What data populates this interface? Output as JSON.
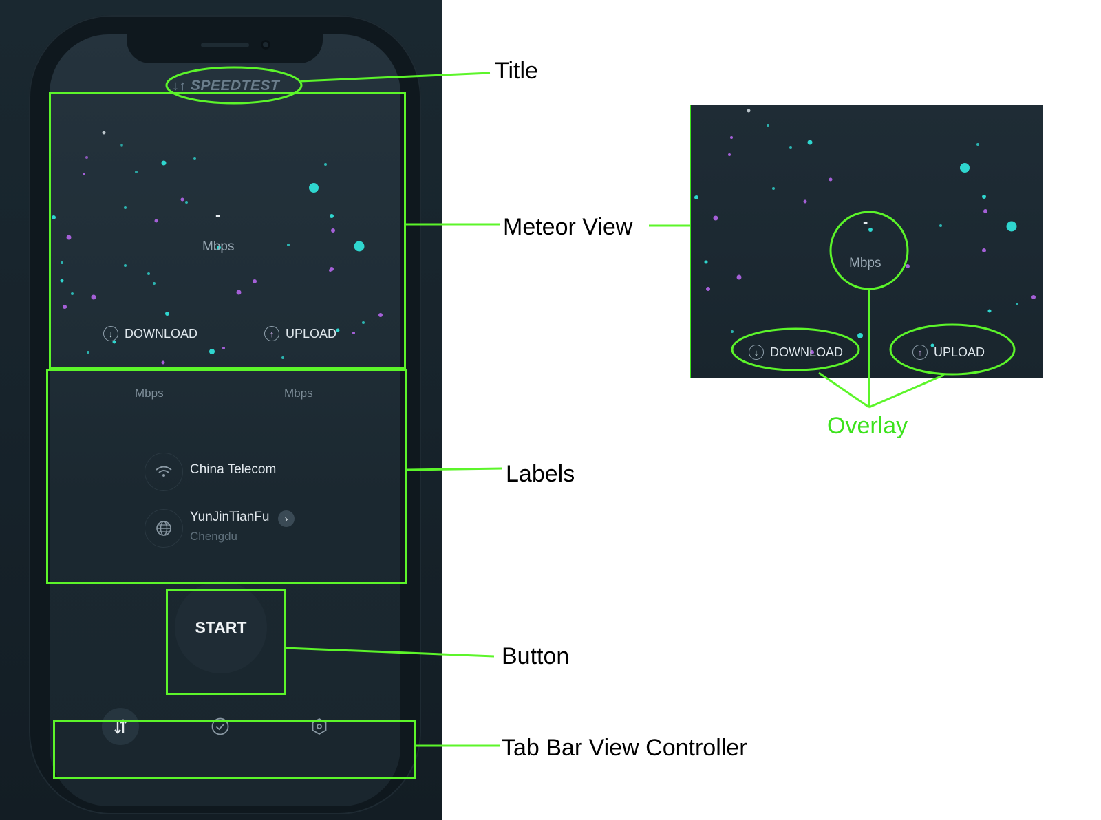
{
  "app": {
    "title": "SPEEDTEST",
    "main_value": "-",
    "main_unit": "Mbps",
    "download_label": "DOWNLOAD",
    "upload_label": "UPLOAD",
    "download_value": "-",
    "download_unit": "Mbps",
    "upload_value": "-",
    "upload_unit": "Mbps",
    "isp_name": "China Telecom",
    "server_name": "YunJinTianFu",
    "server_city": "Chengdu",
    "start_label": "START"
  },
  "tabs": [
    {
      "icon": "speedtest-icon",
      "active": true
    },
    {
      "icon": "check-circle-icon",
      "active": false
    },
    {
      "icon": "hexagon-settings-icon",
      "active": false
    }
  ],
  "annotations": {
    "title": "Title",
    "meteor_view": "Meteor View",
    "labels": "Labels",
    "button": "Button",
    "tab_bar": "Tab Bar View Controller",
    "overlay": "Overlay"
  },
  "overlay_detail": {
    "value": "-",
    "unit": "Mbps",
    "download_label": "DOWNLOAD",
    "upload_label": "UPLOAD"
  },
  "colors": {
    "annotation_green": "#5cf52a",
    "particle_cyan": "#2fd6cf",
    "particle_purple": "#a560d8",
    "background_dark": "#1c2932"
  }
}
